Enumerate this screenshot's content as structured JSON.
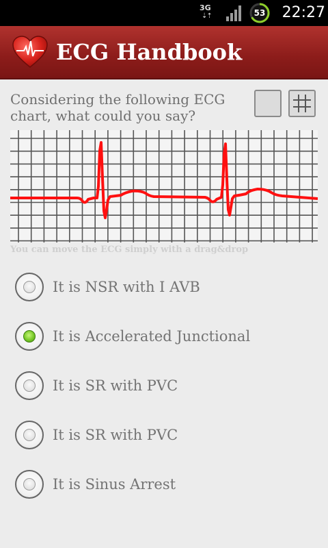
{
  "status_bar": {
    "network_label": "3G",
    "network_arrows": "⇣⇡",
    "signal_icon": "signal-bars-icon",
    "battery_level": "53",
    "battery_icon": "battery-ring-icon",
    "clock": "22:27"
  },
  "title_bar": {
    "logo_icon": "heart-ecg-icon",
    "title": "ECG Handbook"
  },
  "question": {
    "text": "Considering the following ECG chart, what could you say?",
    "toggle_plain_icon": "plain-background-icon",
    "toggle_grid_icon": "grid-icon"
  },
  "chart": {
    "hint": "You can move the ECG simply with a drag&drop"
  },
  "options": [
    {
      "label": "It is NSR with I AVB",
      "checked": false
    },
    {
      "label": "It is Accelerated Junctional",
      "checked": true
    },
    {
      "label": "It is SR with PVC",
      "checked": false
    },
    {
      "label": "It is SR with PVC",
      "checked": false
    },
    {
      "label": "It is Sinus Arrest",
      "checked": false
    }
  ],
  "colors": {
    "title_bar": "#8c1c1a",
    "ecg_trace": "#ff0000",
    "radio_checked": "#78c928",
    "text_gray": "#737373"
  }
}
